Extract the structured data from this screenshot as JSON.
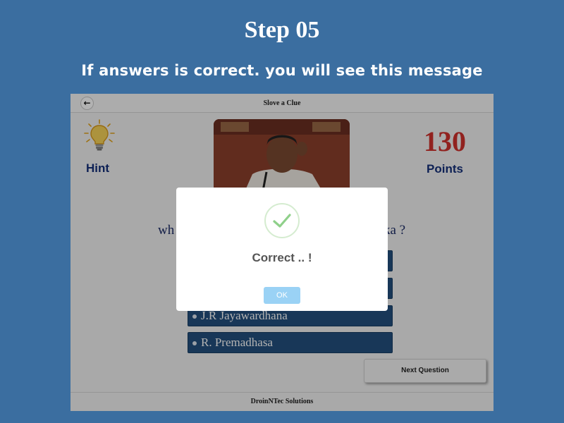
{
  "slide": {
    "title": "Step 05",
    "subtitle": "If answers is correct. you will see this message"
  },
  "app": {
    "header": {
      "back_icon": "arrow-left-icon",
      "title": "Slove a Clue"
    },
    "hint": {
      "icon": "lightbulb-icon",
      "label": "Hint"
    },
    "points": {
      "value": "130",
      "label": "Points"
    },
    "question": {
      "left_fragment": "wh",
      "right_fragment": "ka ?"
    },
    "options": [
      {
        "label": ""
      },
      {
        "label": ""
      },
      {
        "label": "J.R Jayawardhana"
      },
      {
        "label": "R. Premadhasa"
      }
    ],
    "next_button": "Next Question",
    "footer": "DroinNTec Solutions"
  },
  "modal": {
    "icon": "checkmark-icon",
    "title": "Correct .. !",
    "ok_label": "OK"
  },
  "colors": {
    "page_background": "#3b6ea0",
    "option_background": "#23507e",
    "points_color": "#d0312d",
    "label_color": "#15307a",
    "check_color": "#8fd08a",
    "ok_button": "#9ad2f5"
  }
}
